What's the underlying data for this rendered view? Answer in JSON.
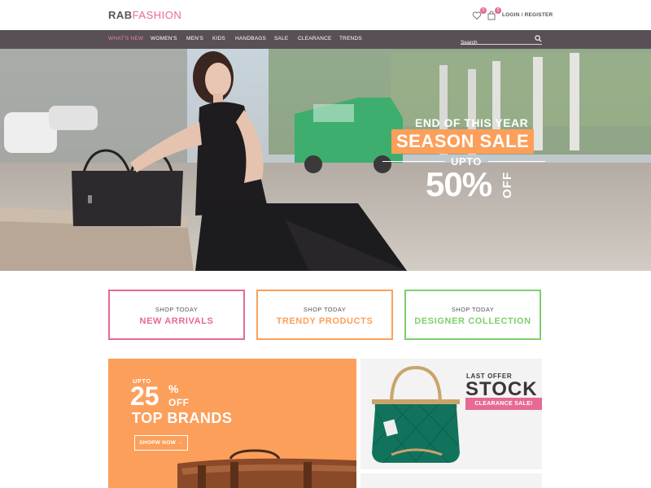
{
  "header": {
    "logo_part1": "RAB",
    "logo_part2": "FASHION",
    "wishlist_count": "0",
    "cart_count": "0",
    "login_label": "LOGIN / REGISTER"
  },
  "nav": {
    "items": [
      "WHAT'S NEW",
      "WOMEN'S",
      "MEN'S",
      "KIDS",
      "HANDBAGS",
      "SALE",
      "CLEARANCE",
      "TRENDS"
    ],
    "active_index": 0,
    "search_placeholder": "Search"
  },
  "hero": {
    "line1": "END OF THIS YEAR",
    "line2": "SEASON SALE",
    "line3": "UPTO",
    "percent": "50%",
    "off": "OFF"
  },
  "promos": [
    {
      "small": "SHOP TODAY",
      "big": "NEW ARRIVALS",
      "color": "#e66a93"
    },
    {
      "small": "SHOP TODAY",
      "big": "TRENDY PRODUCTS",
      "color": "#fc9f5b"
    },
    {
      "small": "SHOP TODAY",
      "big": "DESIGNER COLLECTION",
      "color": "#7dcf6c"
    }
  ],
  "brands": {
    "upto": "UPTO",
    "value": "25",
    "percent": "%",
    "off": "OFF",
    "title": "TOP BRANDS",
    "button": "SHOPW NOW →"
  },
  "stock": {
    "line1": "LAST OFFER",
    "line2": "STOCK",
    "badge": "CLEARANCE SALE!"
  },
  "colors": {
    "pink": "#e66a93",
    "orange": "#fc9f5b",
    "green": "#7dcf6c",
    "nav_bg": "#585056"
  }
}
